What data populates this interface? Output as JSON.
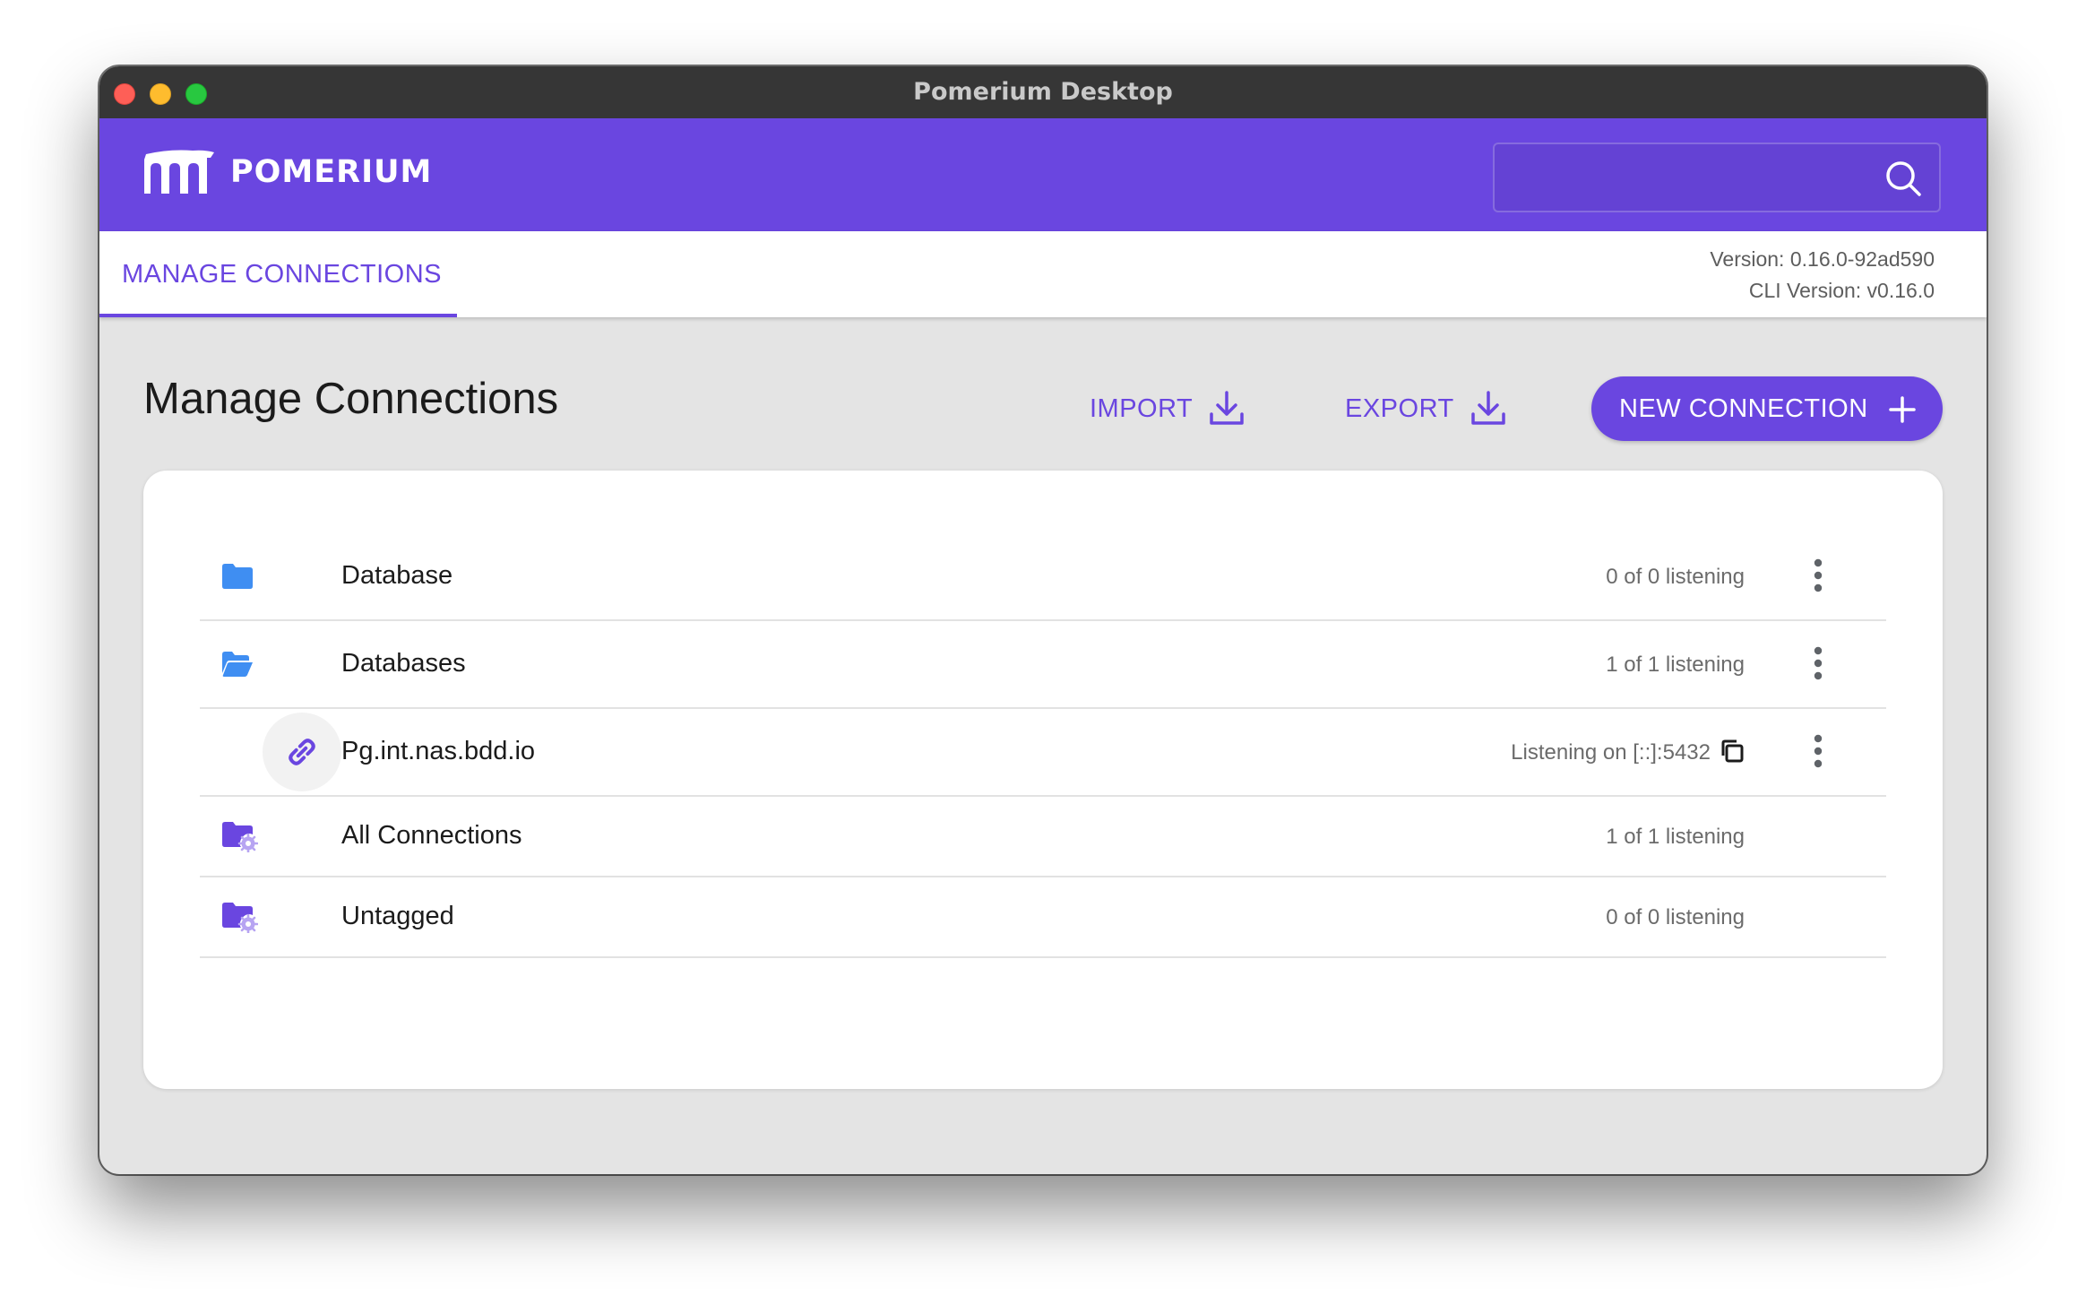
{
  "window": {
    "title": "Pomerium Desktop"
  },
  "header": {
    "brand": "POMERIUM",
    "search": {
      "value": "",
      "placeholder": ""
    }
  },
  "tabs": {
    "active": "MANAGE CONNECTIONS"
  },
  "version": {
    "app": "Version: 0.16.0-92ad590",
    "cli": "CLI Version: v0.16.0"
  },
  "page": {
    "title": "Manage Connections",
    "import_label": "IMPORT",
    "export_label": "EXPORT",
    "new_connection_label": "NEW CONNECTION"
  },
  "rows": [
    {
      "kind": "folder",
      "icon": "folder-icon",
      "label": "Database",
      "status": "0 of 0 listening",
      "menu": true
    },
    {
      "kind": "folder-open",
      "icon": "folder-open-icon",
      "label": "Databases",
      "status": "1 of 1 listening",
      "menu": true
    },
    {
      "kind": "connection",
      "icon": "link-icon",
      "label": "Pg.int.nas.bdd.io",
      "status": "Listening on [::]:5432",
      "menu": true
    },
    {
      "kind": "folder-settings",
      "icon": "folder-settings-icon",
      "label": "All Connections",
      "status": "1 of 1 listening",
      "menu": false
    },
    {
      "kind": "folder-settings",
      "icon": "folder-settings-icon",
      "label": "Untagged",
      "status": "0 of 0 listening",
      "menu": false
    }
  ],
  "colors": {
    "primary": "#6a46e0",
    "folder_blue": "#3f8ef2",
    "titlebar": "#363636",
    "background": "#e4e4e4"
  }
}
